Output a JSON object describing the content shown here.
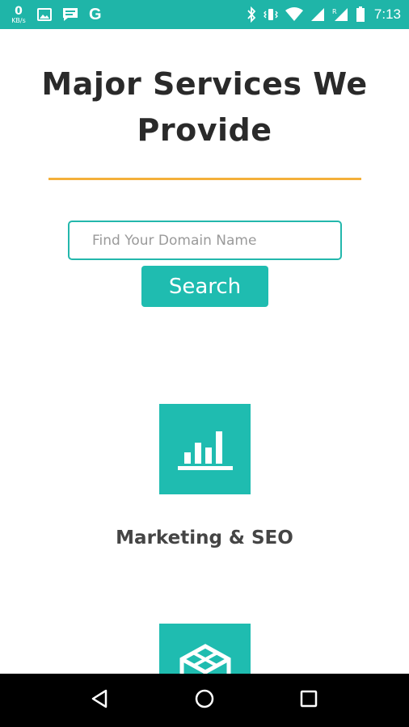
{
  "status_bar": {
    "net_speed_value": "0",
    "net_speed_unit": "KB/s",
    "g_label": "G",
    "clock": "7:13",
    "background_color": "#1fb5a8",
    "left_icons": [
      "image-icon",
      "message-icon",
      "google-icon"
    ],
    "right_icons": [
      "bluetooth-icon",
      "wifi-icon",
      "signal-icon",
      "battery-icon"
    ]
  },
  "page": {
    "title": "Major Services We Provide",
    "divider_color": "#f4b03a",
    "accent_color": "#1fbcb0"
  },
  "search": {
    "placeholder": "Find Your Domain Name",
    "value": "",
    "button_label": "Search"
  },
  "services": [
    {
      "label": "Marketing & SEO",
      "icon": "bar-chart-icon"
    },
    {
      "icon": "cube-icon"
    }
  ],
  "nav_bar": {
    "buttons": [
      "back-icon",
      "home-icon",
      "recents-icon"
    ]
  }
}
